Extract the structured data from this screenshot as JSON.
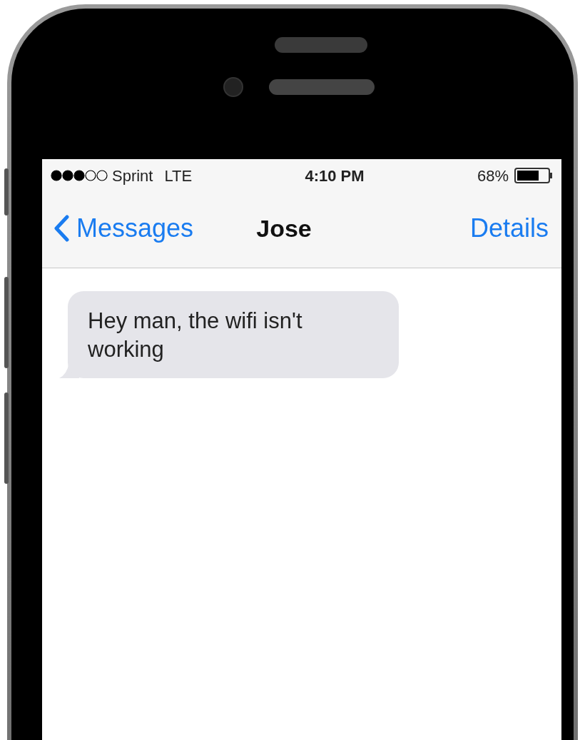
{
  "status_bar": {
    "carrier": "Sprint",
    "network": "LTE",
    "time": "4:10 PM",
    "battery": "68%"
  },
  "nav_bar": {
    "back": "Messages",
    "title": "Jose",
    "action": "Details"
  },
  "messages": [
    {
      "text": "Hey man, the wifi isn't working",
      "kind": "received"
    }
  ]
}
